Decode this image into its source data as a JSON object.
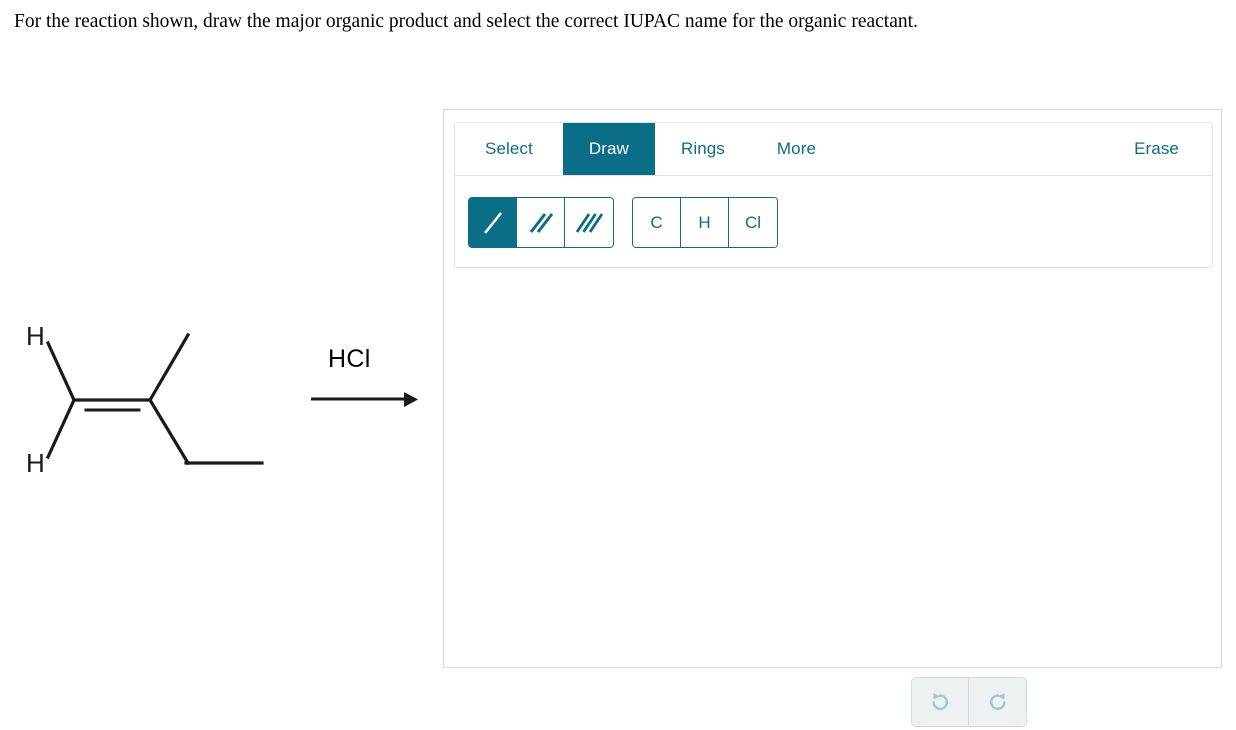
{
  "prompt": {
    "text": "For the reaction shown, draw the major organic product and select the correct IUPAC name for the organic reactant."
  },
  "reaction": {
    "reagent_label": "HCl",
    "reactant_name": "2-methylbut-1-ene",
    "hydrogen_label_top": "H",
    "hydrogen_label_bottom": "H",
    "arrow": "reaction-arrow-right",
    "bond_color": "#1a1a1a"
  },
  "editor": {
    "accent_color": "#0a6e86",
    "disabled_color": "#a9c4ce",
    "tabs": [
      {
        "label": "Select",
        "active": false
      },
      {
        "label": "Draw",
        "active": true
      },
      {
        "label": "Rings",
        "active": false
      },
      {
        "label": "More",
        "active": false
      }
    ],
    "erase_label": "Erase",
    "bond_tools": [
      {
        "name": "single-bond-tool",
        "active": true
      },
      {
        "name": "double-bond-tool",
        "active": false
      },
      {
        "name": "triple-bond-tool",
        "active": false
      }
    ],
    "atom_tools": [
      {
        "label": "C"
      },
      {
        "label": "H"
      },
      {
        "label": "Cl"
      }
    ],
    "history_tools": [
      {
        "name": "undo-button",
        "enabled": false
      },
      {
        "name": "redo-button",
        "enabled": false
      }
    ],
    "zoom_tools": [
      {
        "name": "zoom-in-button"
      },
      {
        "name": "zoom-reset-button"
      },
      {
        "name": "zoom-out-button"
      }
    ]
  }
}
